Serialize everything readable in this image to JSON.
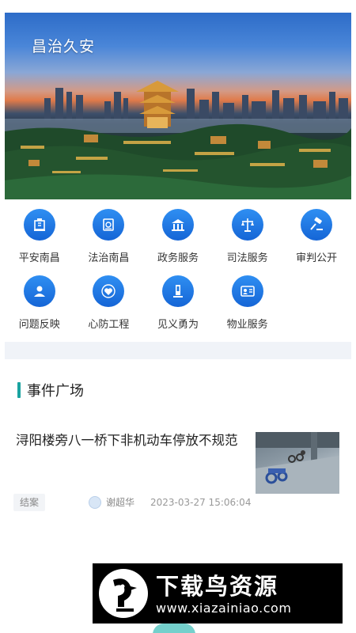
{
  "hero": {
    "title": "昌治久安"
  },
  "grid": {
    "row1": [
      {
        "label": "平安南昌",
        "icon": "building-icon"
      },
      {
        "label": "法治南昌",
        "icon": "law-book-icon"
      },
      {
        "label": "政务服务",
        "icon": "government-hall-icon"
      },
      {
        "label": "司法服务",
        "icon": "scales-icon"
      },
      {
        "label": "审判公开",
        "icon": "gavel-icon"
      }
    ],
    "row2": [
      {
        "label": "问题反映",
        "icon": "user-report-icon"
      },
      {
        "label": "心防工程",
        "icon": "heart-icon"
      },
      {
        "label": "见义勇为",
        "icon": "hero-figure-icon"
      },
      {
        "label": "物业服务",
        "icon": "id-card-icon"
      }
    ]
  },
  "section": {
    "title": "事件广场"
  },
  "event": {
    "title": "浔阳楼旁八一桥下非机动车停放不规范",
    "status": "结案",
    "author": "谢超华",
    "time": "2023-03-27 15:06:04"
  },
  "watermark": {
    "name": "下载鸟资源",
    "url": "www.xiazainiao.com"
  },
  "colors": {
    "accent_blue": "#1f7ae0",
    "section_bar": "#1aa3a0"
  }
}
